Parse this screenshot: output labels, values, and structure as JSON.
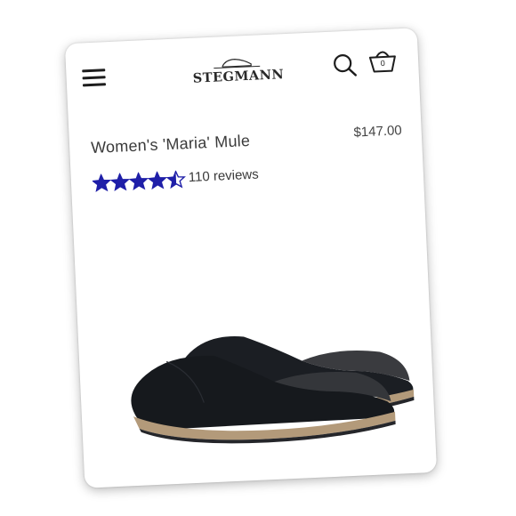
{
  "header": {
    "brand": "STEGMANN",
    "menu_icon": "hamburger-menu-icon",
    "search_icon": "search-icon",
    "cart_icon": "basket-icon",
    "cart_count": "0"
  },
  "product": {
    "title": "Women's 'Maria' Mule",
    "price": "$147.00",
    "rating": 4.5,
    "rating_max": 5,
    "reviews_label": "110 reviews",
    "image": "black-leather-clog-mules-pair"
  },
  "colors": {
    "star": "#1f1fa8",
    "text": "#3a3a3a",
    "shoe_leather": "#1b1e23",
    "cork_sole": "#b39a7a"
  }
}
